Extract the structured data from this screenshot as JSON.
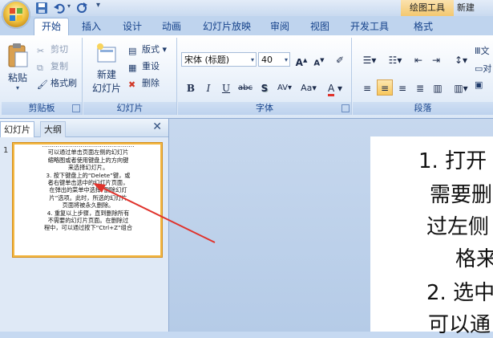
{
  "qat": {
    "save": "save-icon",
    "undo": "undo-icon",
    "redo": "redo-icon",
    "customize": "▾"
  },
  "title": {
    "contextual_tab": "绘图工具",
    "text": "新建 Mic"
  },
  "tabs": [
    "开始",
    "插入",
    "设计",
    "动画",
    "幻灯片放映",
    "审阅",
    "视图",
    "开发工具",
    "格式"
  ],
  "ribbon": {
    "clipboard": {
      "paste": "粘贴",
      "cut": "剪切",
      "copy": "复制",
      "format_painter": "格式刷",
      "label": "剪贴板"
    },
    "slides": {
      "new_slide_1": "新建",
      "new_slide_2": "幻灯片",
      "layout": "版式",
      "reset": "重设",
      "delete": "删除",
      "label": "幻灯片"
    },
    "font": {
      "font_name": "宋体 (标题)",
      "font_size": "40",
      "grow": "A",
      "shrink": "A",
      "bold": "B",
      "italic": "I",
      "underline": "U",
      "strike": "abc",
      "shadow": "S",
      "spacing": "AV",
      "case": "Aa",
      "color": "A",
      "label": "字体"
    },
    "paragraph": {
      "label": "段落"
    },
    "drawing_partial": {
      "text_direction": "文",
      "align": "对"
    }
  },
  "leftpane": {
    "tab_slides": "幻灯片",
    "tab_outline": "大纲",
    "close": "✕",
    "slide_number": "1",
    "thumb_lines": [
      "…………………………………………",
      "可以通过单击页面左侧的幻灯片",
      "缩略图或者使用键盘上的方向键",
      "来选择幻灯片。",
      "3. 按下键盘上的“Delete”键，或",
      "者右键单击选中的幻灯片页面，",
      "在弹出的菜单中选择“删除幻灯",
      "片”选项。此时，所选的幻灯片",
      "页面将被永久删除。",
      "4. 重复以上步骤，直到删除所有",
      "不需要的幻灯片页面。在删除过",
      "程中，可以通过按下“Ctrl+Z”组合"
    ]
  },
  "slide": {
    "lines": [
      "1. 打开",
      "需要删",
      "过左侧",
      "格来",
      "2. 选中",
      "可以通"
    ]
  },
  "colors": {
    "ribbon_text": "#15428b",
    "accent_orange": "#f3b640",
    "arrow_red": "#e0322b"
  }
}
